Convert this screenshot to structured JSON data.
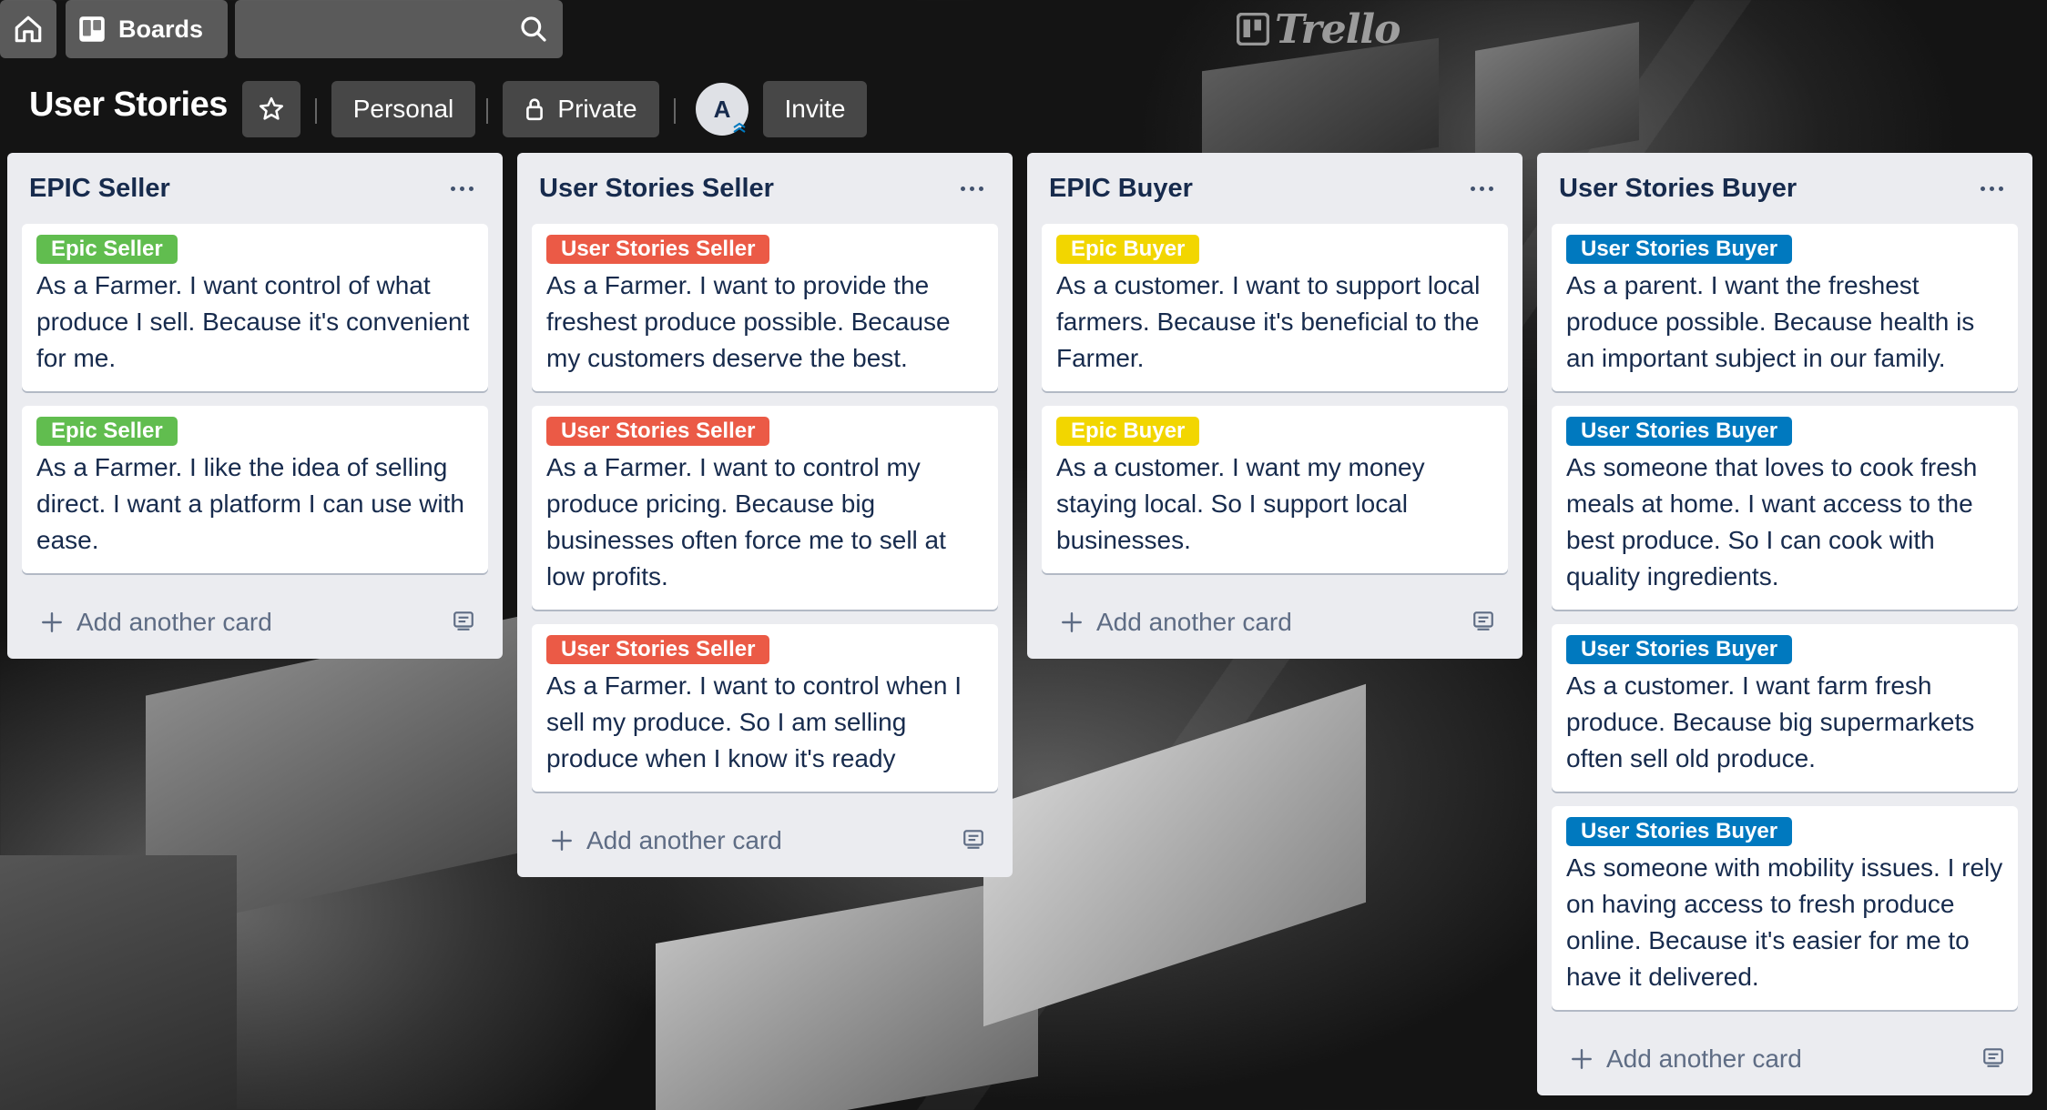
{
  "nav": {
    "boards_label": "Boards",
    "search_value": "",
    "logo_text": "Trello"
  },
  "board": {
    "title": "User Stories",
    "visibility_team": "Personal",
    "visibility_privacy": "Private",
    "member_initial": "A",
    "invite_label": "Invite"
  },
  "colors": {
    "green_label": "#61bd4f",
    "red_label": "#eb5a46",
    "yellow_label": "#f2d600",
    "blue_label": "#0079bf"
  },
  "add_card_label": "Add another card",
  "lists": [
    {
      "title": "EPIC Seller",
      "cards": [
        {
          "label": "Epic Seller",
          "color": "green",
          "text": "As a Farmer. I want control of what produce I sell. Because it's convenient for me."
        },
        {
          "label": "Epic Seller",
          "color": "green",
          "text": "As a Farmer. I like the idea of selling direct. I want a platform I can use with ease."
        }
      ]
    },
    {
      "title": "User Stories Seller",
      "cards": [
        {
          "label": "User Stories Seller",
          "color": "red",
          "text": "As a Farmer. I want to provide the freshest produce possible. Because my customers deserve the best."
        },
        {
          "label": "User Stories Seller",
          "color": "red",
          "text": "As a Farmer. I want to control my produce pricing. Because big businesses often force me to sell at low profits."
        },
        {
          "label": "User Stories Seller",
          "color": "red",
          "text": "As a Farmer. I want to control when I sell my produce. So I am selling produce when I know it's ready"
        }
      ]
    },
    {
      "title": "EPIC Buyer",
      "cards": [
        {
          "label": "Epic Buyer",
          "color": "yellow",
          "text": "As a customer. I want to support local farmers. Because it's beneficial to the Farmer."
        },
        {
          "label": "Epic Buyer",
          "color": "yellow",
          "text": "As a customer. I want my money staying local. So I support local businesses."
        }
      ]
    },
    {
      "title": "User Stories Buyer",
      "cards": [
        {
          "label": "User Stories Buyer",
          "color": "blue",
          "text": "As a parent. I want the freshest produce possible. Because health is an important subject in our family."
        },
        {
          "label": "User Stories Buyer",
          "color": "blue",
          "text": "As someone that loves to cook fresh meals at home. I want access to the best produce. So I can cook with quality ingredients."
        },
        {
          "label": "User Stories Buyer",
          "color": "blue",
          "text": "As a customer. I want farm fresh produce. Because big supermarkets often sell old produce."
        },
        {
          "label": "User Stories Buyer",
          "color": "blue",
          "text": "As someone with mobility issues. I rely on having access to fresh produce online. Because it's easier for me to have it delivered."
        }
      ]
    }
  ]
}
